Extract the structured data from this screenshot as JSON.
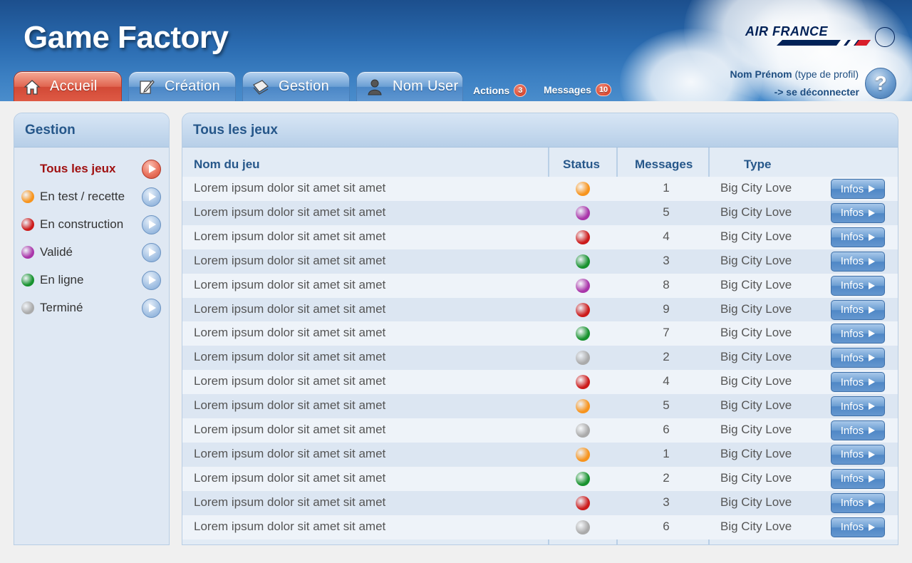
{
  "header": {
    "app_title": "Game Factory",
    "logo_text": "AIR FRANCE",
    "tabs": [
      {
        "label": "Accueil",
        "icon": "home-icon",
        "active": true
      },
      {
        "label": "Création",
        "icon": "edit-icon",
        "active": false
      },
      {
        "label": "Gestion",
        "icon": "folder-icon",
        "active": false
      },
      {
        "label": "Nom User",
        "icon": "user-icon",
        "active": false
      }
    ],
    "actions": {
      "label": "Actions",
      "count": "3"
    },
    "messages": {
      "label": "Messages",
      "count": "10"
    },
    "user": {
      "name": "Nom Prénom",
      "profile": "(type de profil)",
      "logout": "-> se déconnecter"
    },
    "help_symbol": "?"
  },
  "sidebar": {
    "title": "Gestion",
    "items": [
      {
        "label": "Tous les jeux",
        "color": "",
        "active": true
      },
      {
        "label": "En test / recette",
        "color": "#f7941d"
      },
      {
        "label": "En construction",
        "color": "#cc1b1b"
      },
      {
        "label": "Validé",
        "color": "#a935a9"
      },
      {
        "label": "En ligne",
        "color": "#17922e"
      },
      {
        "label": "Terminé",
        "color": "#aaaaaa"
      }
    ]
  },
  "main": {
    "title": "Tous les jeux",
    "columns": {
      "name": "Nom du jeu",
      "status": "Status",
      "messages": "Messages",
      "type": "Type"
    },
    "info_label": "Infos",
    "status_colors": {
      "orange": "#f7941d",
      "purple": "#a935a9",
      "red": "#cc1b1b",
      "green": "#17922e",
      "grey": "#aaaaaa"
    },
    "rows": [
      {
        "name": "Lorem ipsum dolor sit amet sit amet",
        "status": "orange",
        "messages": "1",
        "type": "Big City Love"
      },
      {
        "name": "Lorem ipsum dolor sit amet sit amet",
        "status": "purple",
        "messages": "5",
        "type": "Big City Love"
      },
      {
        "name": "Lorem ipsum dolor sit amet sit amet",
        "status": "red",
        "messages": "4",
        "type": "Big City Love"
      },
      {
        "name": "Lorem ipsum dolor sit amet sit amet",
        "status": "green",
        "messages": "3",
        "type": "Big City Love"
      },
      {
        "name": "Lorem ipsum dolor sit amet sit amet",
        "status": "purple",
        "messages": "8",
        "type": "Big City Love"
      },
      {
        "name": "Lorem ipsum dolor sit amet sit amet",
        "status": "red",
        "messages": "9",
        "type": "Big City Love"
      },
      {
        "name": "Lorem ipsum dolor sit amet sit amet",
        "status": "green",
        "messages": "7",
        "type": "Big City Love"
      },
      {
        "name": "Lorem ipsum dolor sit amet sit amet",
        "status": "grey",
        "messages": "2",
        "type": "Big City Love"
      },
      {
        "name": "Lorem ipsum dolor sit amet sit amet",
        "status": "red",
        "messages": "4",
        "type": "Big City Love"
      },
      {
        "name": "Lorem ipsum dolor sit amet sit amet",
        "status": "orange",
        "messages": "5",
        "type": "Big City Love"
      },
      {
        "name": "Lorem ipsum dolor sit amet sit amet",
        "status": "grey",
        "messages": "6",
        "type": "Big City Love"
      },
      {
        "name": "Lorem ipsum dolor sit amet sit amet",
        "status": "orange",
        "messages": "1",
        "type": "Big City Love"
      },
      {
        "name": "Lorem ipsum dolor sit amet sit amet",
        "status": "green",
        "messages": "2",
        "type": "Big City Love"
      },
      {
        "name": "Lorem ipsum dolor sit amet sit amet",
        "status": "red",
        "messages": "3",
        "type": "Big City Love"
      },
      {
        "name": "Lorem ipsum dolor sit amet sit amet",
        "status": "grey",
        "messages": "6",
        "type": "Big City Love"
      }
    ]
  }
}
